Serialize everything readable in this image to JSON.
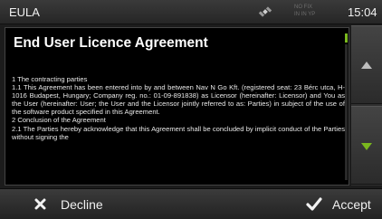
{
  "header": {
    "title": "EULA",
    "gps_status_line1": "NO FIX",
    "gps_status_line2": "IN IN YP",
    "clock": "15:04"
  },
  "document": {
    "title": "End User Licence Agreement",
    "paragraphs": [
      "1 The contracting parties",
      "1.1 This Agreement has been entered into by and between Nav N Go Kft. (registered seat: 23 Bérc utca, H-1016 Budapest, Hungary; Company reg. no.: 01-09-891838) as Licensor (hereinafter: Licensor) and You as the User (hereinafter: User; the User and the Licensor jointly referred to as: Parties) in subject of the use of the software product specified in this Agreement.",
      "2 Conclusion of the Agreement",
      "2.1 The Parties hereby acknowledge that this Agreement shall be concluded by implicit conduct of the Parties without signing the"
    ]
  },
  "footer": {
    "decline_label": "Decline",
    "accept_label": "Accept"
  },
  "icons": {
    "gps": "satellite-icon",
    "scroll_up": "arrow-up-icon",
    "scroll_down": "arrow-down-icon",
    "decline": "x-icon",
    "accept": "checkmark-icon"
  },
  "colors": {
    "accent_green": "#7ab81e",
    "background": "#000000"
  }
}
